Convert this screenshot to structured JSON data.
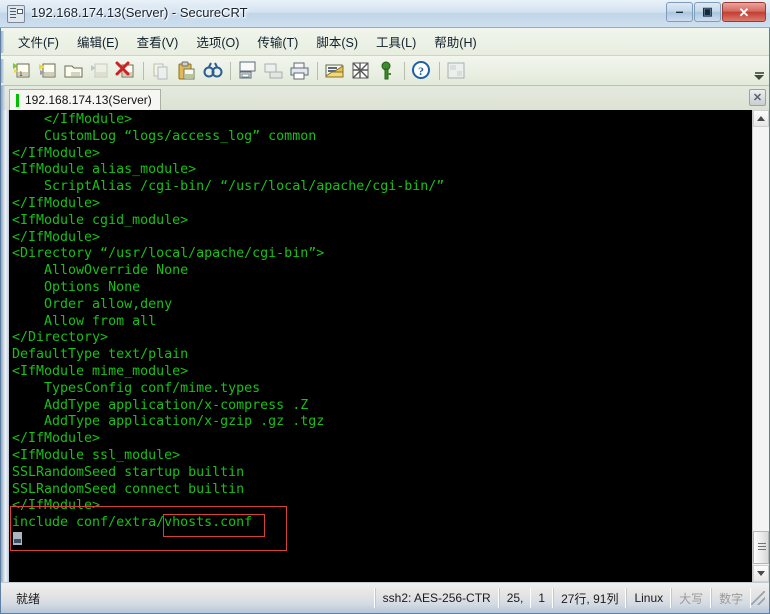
{
  "window": {
    "title": "192.168.174.13(Server) - SecureCRT",
    "icon": "securecrt-icon",
    "controls": {
      "minimize": "–",
      "maximize": "▣",
      "close": "✕"
    }
  },
  "menubar": {
    "items": [
      {
        "label": "文件(F)",
        "name": "menu-file"
      },
      {
        "label": "编辑(E)",
        "name": "menu-edit"
      },
      {
        "label": "查看(V)",
        "name": "menu-view"
      },
      {
        "label": "选项(O)",
        "name": "menu-options"
      },
      {
        "label": "传输(T)",
        "name": "menu-transfer"
      },
      {
        "label": "脚本(S)",
        "name": "menu-script"
      },
      {
        "label": "工具(L)",
        "name": "menu-tools"
      },
      {
        "label": "帮助(H)",
        "name": "menu-help"
      }
    ]
  },
  "toolbar": {
    "icons": [
      "new-session-icon",
      "clone-session-icon",
      "connect-folder-icon",
      "connect-local-shell-icon",
      "disconnect-icon",
      "copy-icon",
      "paste-icon",
      "find-icon",
      "print-screen-icon",
      "log-session-icon",
      "print-icon",
      "session-options-icon",
      "protocol-options-icon",
      "key-icon",
      "help-icon",
      "tile-windows-icon"
    ],
    "overflow_label": "»"
  },
  "tabs": [
    {
      "label": "192.168.174.13(Server)",
      "active": true,
      "led_color": "#00c000"
    }
  ],
  "tab_close_label": "✕",
  "terminal": {
    "fg_color": "#18c018",
    "bg_color": "#000000",
    "lines": [
      "    </IfModule>",
      "    CustomLog “logs/access_log” common",
      "</IfModule>",
      "<IfModule alias_module>",
      "    ScriptAlias /cgi-bin/ “/usr/local/apache/cgi-bin/”",
      "</IfModule>",
      "<IfModule cgid_module>",
      "</IfModule>",
      "<Directory “/usr/local/apache/cgi-bin”>",
      "    AllowOverride None",
      "    Options None",
      "    Order allow,deny",
      "    Allow from all",
      "</Directory>",
      "DefaultType text/plain",
      "<IfModule mime_module>",
      "    TypesConfig conf/mime.types",
      "    AddType application/x-compress .Z",
      "    AddType application/x-gzip .gz .tgz",
      "</IfModule>",
      "<IfModule ssl_module>",
      "SSLRandomSeed startup builtin",
      "SSLRandomSeed connect builtin",
      "</IfModule>",
      "include conf/extra/vhosts.conf",
      "",
      ""
    ]
  },
  "annotations": {
    "color": "#d4423a",
    "outer_box_target": "include conf/extra/vhosts.conf",
    "inner_box_target": "vhosts.conf"
  },
  "scrollbar": {
    "up_arrow": "▲",
    "down_arrow": "▼",
    "thumb_position": "bottom"
  },
  "statusbar": {
    "ready": "就绪",
    "cipher": "ssh2: AES-256-CTR",
    "cursor_row": "25,",
    "cursor_col": "1",
    "dimensions": "27行, 91列",
    "emulation": "Linux",
    "caps": "大写",
    "num": "数字"
  }
}
